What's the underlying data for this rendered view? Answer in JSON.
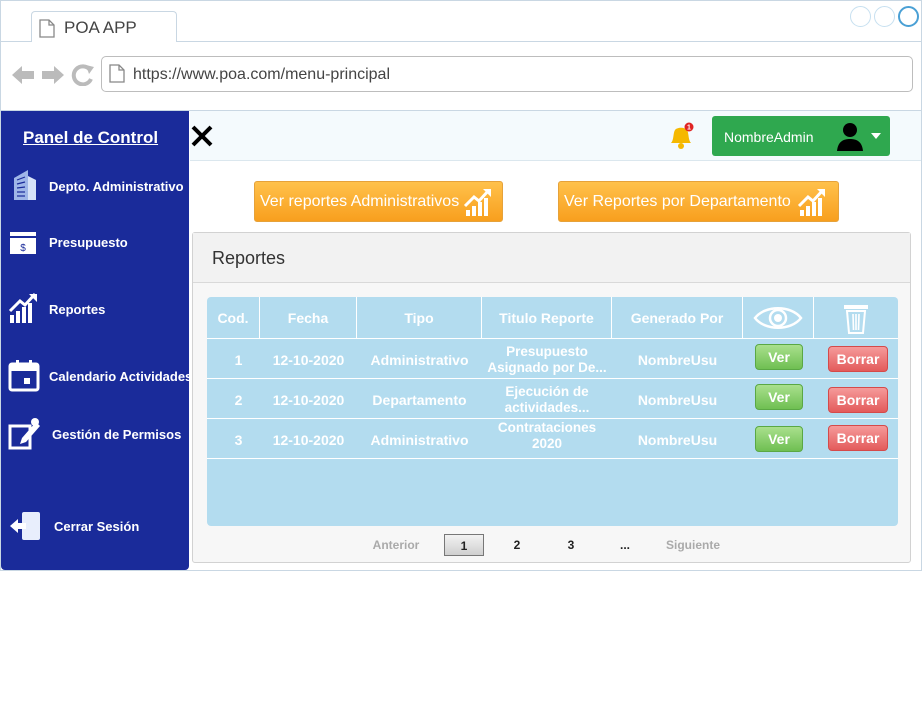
{
  "browser": {
    "tab_title": "POA APP",
    "url": "https://www.poa.com/menu-principal"
  },
  "sidebar": {
    "title": "Panel de Control",
    "items": [
      {
        "label": "Depto. Administrativo",
        "icon": "building-icon"
      },
      {
        "label": "Presupuesto",
        "icon": "money-icon"
      },
      {
        "label": "Reportes",
        "icon": "chart-up-icon"
      },
      {
        "label": "Calendario Actividades",
        "icon": "calendar-icon"
      },
      {
        "label": "Gestión de Permisos",
        "icon": "edit-permissions-icon"
      },
      {
        "label": "Cerrar Sesión",
        "icon": "logout-icon"
      }
    ]
  },
  "header": {
    "notification_count": "1",
    "admin_name": "NombreAdmin"
  },
  "actions": {
    "admin_reports": "Ver reportes Administrativos",
    "dept_reports": "Ver Reportes por Departamento"
  },
  "reports": {
    "title": "Reportes",
    "columns": [
      "Cod.",
      "Fecha",
      "Tipo",
      "Titulo Reporte",
      "Generado Por"
    ],
    "rows": [
      {
        "cod": "1",
        "fecha": "12-10-2020",
        "tipo": "Administrativo",
        "titulo": "Presupuesto Asignado por De...",
        "generado": "NombreUsu",
        "ver": "Ver",
        "borrar": "Borrar"
      },
      {
        "cod": "2",
        "fecha": "12-10-2020",
        "tipo": "Departamento",
        "titulo": "Ejecución de actividades...",
        "generado": "NombreUsu",
        "ver": "Ver",
        "borrar": "Borrar"
      },
      {
        "cod": "3",
        "fecha": "12-10-2020",
        "tipo": "Administrativo",
        "titulo": "Contrataciones 2020",
        "generado": "NombreUsu",
        "ver": "Ver",
        "borrar": "Borrar"
      }
    ]
  },
  "pagination": {
    "prev": "Anterior",
    "pages": [
      "1",
      "2",
      "3",
      "..."
    ],
    "current": "1",
    "next": "Siguiente"
  },
  "colors": {
    "sidebar": "#1a2b9a",
    "accent_orange": "#f89f1e",
    "admin_green": "#2fa84f",
    "table_blue": "#b3dcef",
    "ver_green": "#6fbf52",
    "borrar_red": "#e35b5b"
  }
}
